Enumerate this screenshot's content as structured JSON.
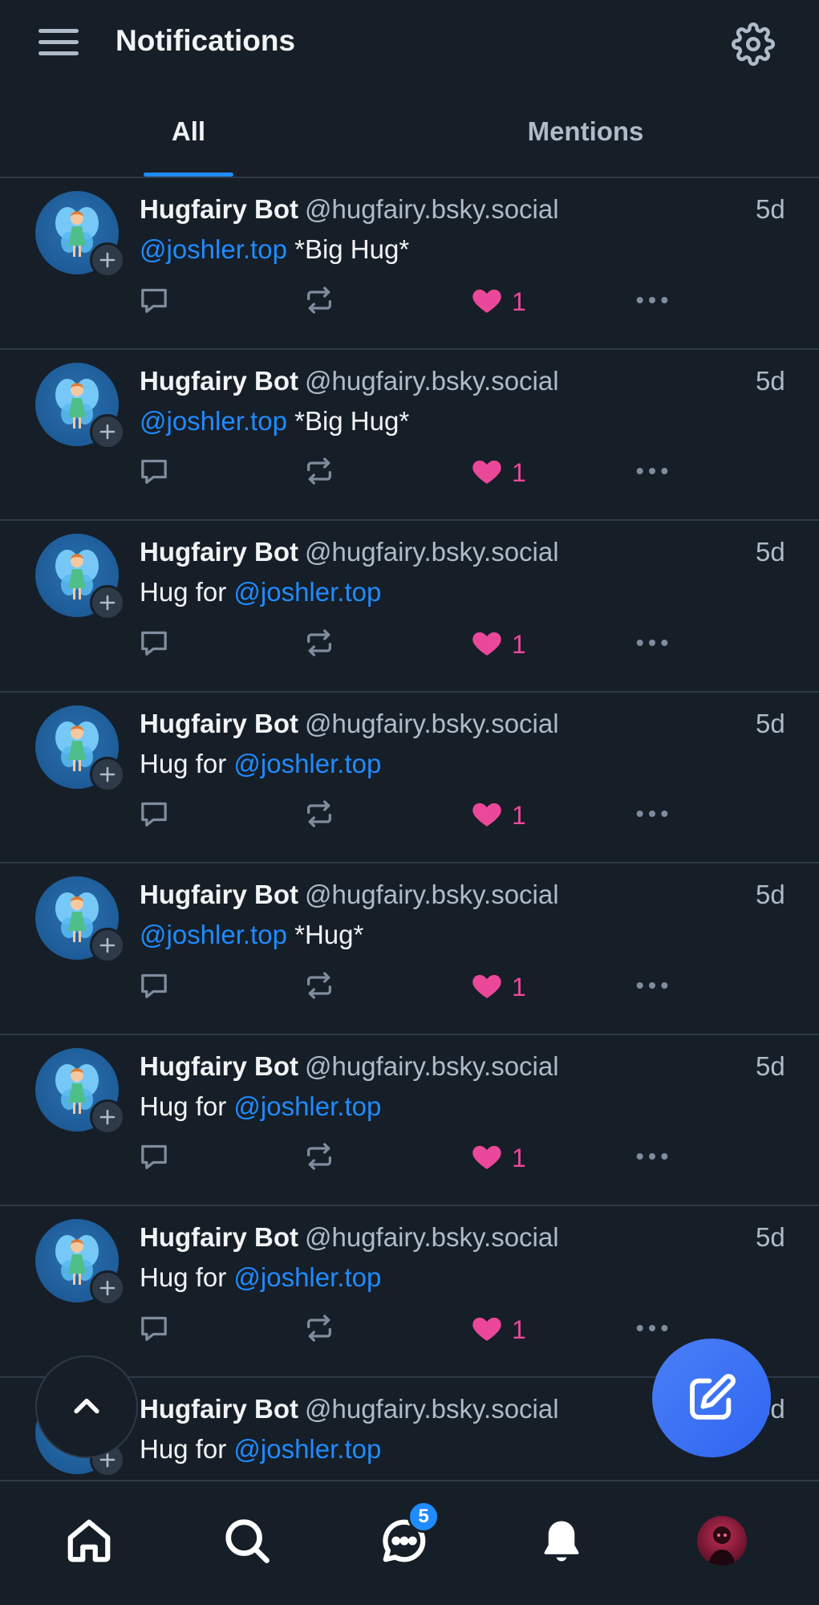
{
  "header": {
    "title": "Notifications"
  },
  "tabs": [
    {
      "label": "All",
      "active": true
    },
    {
      "label": "Mentions",
      "active": false
    }
  ],
  "notifications": [
    {
      "name": "Hugfairy Bot",
      "handle": "@hugfairy.bsky.social",
      "time": "5d",
      "pre": "",
      "mention": "@joshler.top",
      "post": " *Big Hug*",
      "likes": "1"
    },
    {
      "name": "Hugfairy Bot",
      "handle": "@hugfairy.bsky.social",
      "time": "5d",
      "pre": "",
      "mention": "@joshler.top",
      "post": " *Big Hug*",
      "likes": "1"
    },
    {
      "name": "Hugfairy Bot",
      "handle": "@hugfairy.bsky.social",
      "time": "5d",
      "pre": "Hug for ",
      "mention": "@joshler.top",
      "post": "",
      "likes": "1"
    },
    {
      "name": "Hugfairy Bot",
      "handle": "@hugfairy.bsky.social",
      "time": "5d",
      "pre": "Hug for ",
      "mention": "@joshler.top",
      "post": "",
      "likes": "1"
    },
    {
      "name": "Hugfairy Bot",
      "handle": "@hugfairy.bsky.social",
      "time": "5d",
      "pre": "",
      "mention": "@joshler.top",
      "post": " *Hug*",
      "likes": "1"
    },
    {
      "name": "Hugfairy Bot",
      "handle": "@hugfairy.bsky.social",
      "time": "5d",
      "pre": "Hug for ",
      "mention": "@joshler.top",
      "post": "",
      "likes": "1"
    },
    {
      "name": "Hugfairy Bot",
      "handle": "@hugfairy.bsky.social",
      "time": "5d",
      "pre": "Hug for ",
      "mention": "@joshler.top",
      "post": "",
      "likes": "1"
    },
    {
      "name": "Hugfairy Bot",
      "handle": "@hugfairy.bsky.social",
      "time": "5d",
      "pre": "Hug for ",
      "mention": "@joshler.top",
      "post": "",
      "likes": ""
    }
  ],
  "nav": {
    "chat_badge": "5",
    "icons": [
      "home-icon",
      "search-icon",
      "chat-icon",
      "bell-icon",
      "profile-avatar"
    ]
  },
  "colors": {
    "background": "#161e27",
    "accent": "#208bfe",
    "like": "#ec4899",
    "muted": "#aebbc9",
    "fab": "#3b73f3"
  }
}
